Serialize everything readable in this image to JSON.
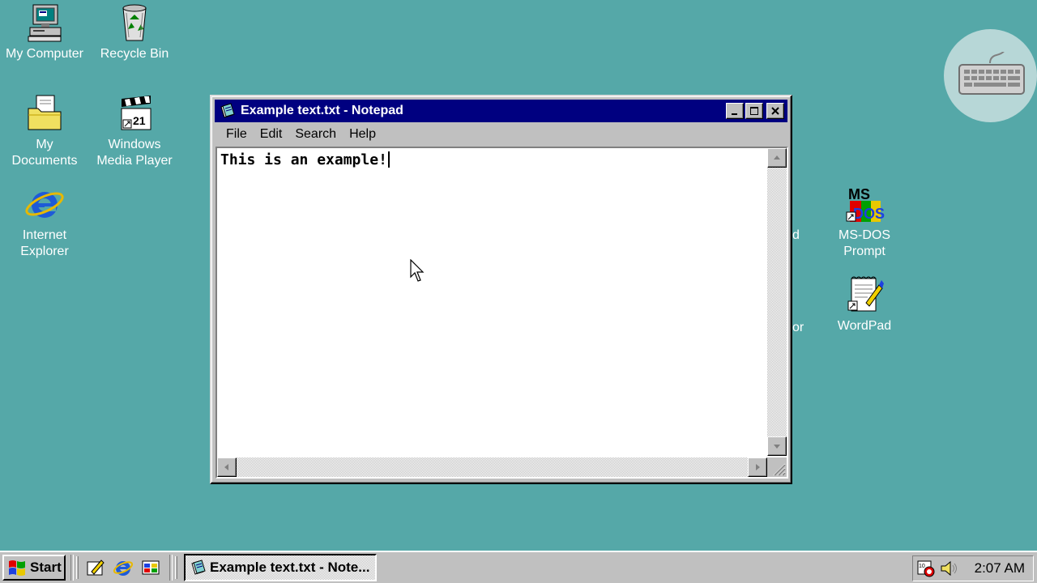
{
  "desktop": {
    "background": "#55A8A8",
    "icons": [
      {
        "label": "My Computer",
        "icon": "my-computer-icon"
      },
      {
        "label": "Recycle Bin",
        "icon": "recycle-bin-icon"
      },
      {
        "label": "My\nDocuments",
        "icon": "my-documents-icon"
      },
      {
        "label": "Windows\nMedia Player",
        "icon": "media-player-icon"
      },
      {
        "label": "Internet\nExplorer",
        "icon": "internet-explorer-icon"
      },
      {
        "label": "MS-DOS\nPrompt",
        "icon": "msdos-icon"
      },
      {
        "label": "WordPad",
        "icon": "wordpad-icon"
      }
    ],
    "partial_labels": [
      "d",
      "or"
    ]
  },
  "notepad": {
    "title": "Example text.txt - Notepad",
    "menu": [
      "File",
      "Edit",
      "Search",
      "Help"
    ],
    "content": "This is an example!"
  },
  "taskbar": {
    "start_label": "Start",
    "task_label": "Example text.txt - Note...",
    "clock": "2:07 AM"
  },
  "colors": {
    "titlebar": "#000080",
    "chrome": "#C0C0C0"
  }
}
